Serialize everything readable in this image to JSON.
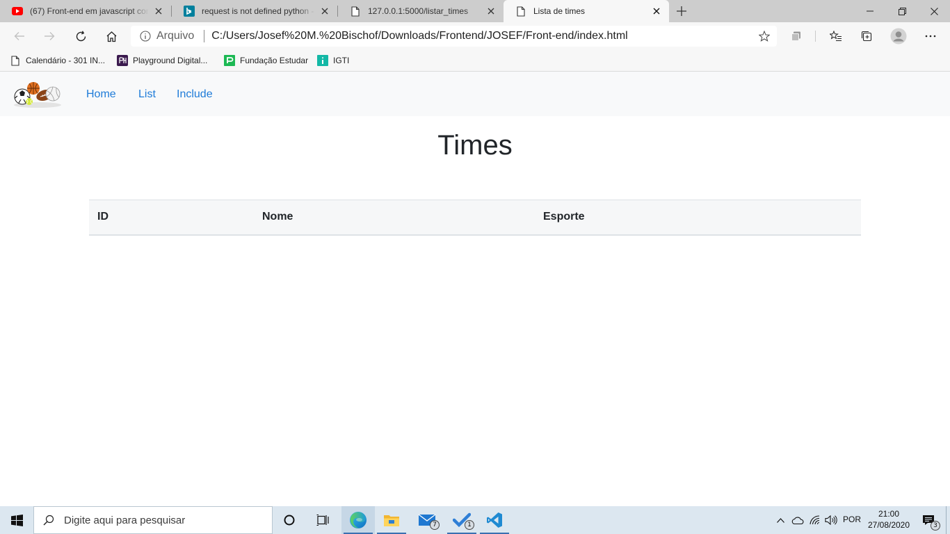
{
  "browser": {
    "tabs": [
      {
        "title": "(67) Front-end em javascript com",
        "favicon": "youtube-icon"
      },
      {
        "title": "request is not defined python - B",
        "favicon": "bing-icon"
      },
      {
        "title": "127.0.0.1:5000/listar_times",
        "favicon": "page-icon"
      },
      {
        "title": "Lista de times",
        "favicon": "page-icon",
        "active": true
      }
    ],
    "address": {
      "protocol_label": "Arquivo",
      "url": "C:/Users/Josef%20M.%20Bischof/Downloads/Frontend/JOSEF/Front-end/index.html"
    },
    "favorites": [
      {
        "label": "Calendário - 301 IN...",
        "icon": "page-icon"
      },
      {
        "label": "Playground Digital...",
        "icon": "playground-icon"
      },
      {
        "label": "Fundação Estudar",
        "icon": "fundacao-icon"
      },
      {
        "label": "IGTI",
        "icon": "igti-icon"
      }
    ]
  },
  "page": {
    "nav": {
      "links": [
        "Home",
        "List",
        "Include"
      ]
    },
    "title": "Times",
    "table": {
      "columns": [
        "ID",
        "Nome",
        "Esporte"
      ],
      "rows": []
    }
  },
  "taskbar": {
    "search_placeholder": "Digite aqui para pesquisar",
    "mail_badge": "7",
    "todo_badge": "1",
    "language": "POR",
    "time": "21:00",
    "date": "27/08/2020",
    "notifications": "3"
  },
  "colors": {
    "link": "#1e7bd8",
    "taskbar": "#dce7f0",
    "tabstrip": "#cdcdcd"
  }
}
